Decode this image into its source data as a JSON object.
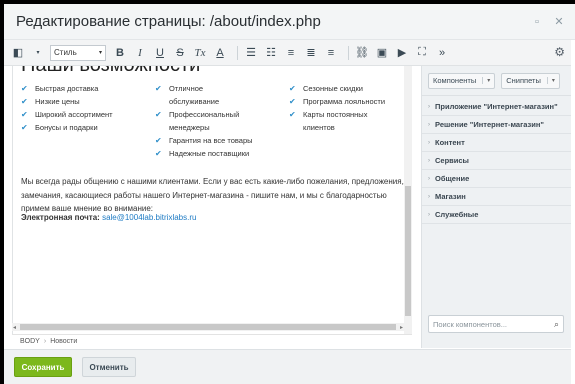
{
  "window": {
    "title": "Редактирование страницы: /about/index.php",
    "minimize_icon": "minimize-icon",
    "close_icon": "close-icon"
  },
  "toolbar": {
    "style_select": {
      "value": "Стиль"
    },
    "format_buttons": [
      "B",
      "I",
      "U",
      "S",
      "Tx",
      "A"
    ],
    "more": "»"
  },
  "editor": {
    "heading": "Наши возможности",
    "features": {
      "col1": [
        "Быстрая доставка",
        "Низкие цены",
        "Широкий ассортимент",
        "Бонусы и подарки"
      ],
      "col2": [
        "Отличное обслуживание",
        "Профессиональный менеджеры",
        "Гарантия на все товары",
        "Надежные поставщики"
      ],
      "col3": [
        "Сезонные скидки",
        "Программа лояльности",
        "Карты постоянных клиентов"
      ]
    },
    "paragraph": "Мы всегда рады общению с нашими клиентами. Если у вас есть какие-либо пожелания, предложения, замечания, касающиеся работы нашего Интернет-магазина - пишите нам, и мы с благодарностью примем ваше мнение во внимание:",
    "email_label": "Электронная почта",
    "email_value": "sale@1004lab.bitrixlabs.ru"
  },
  "statusbar": {
    "path": [
      "BODY",
      "Новости"
    ]
  },
  "panel": {
    "tabs": [
      {
        "label": "Компоненты"
      },
      {
        "label": "Сниппеты"
      }
    ],
    "groups": [
      "Приложение \"Интернет-магазин\"",
      "Решение \"Интернет-магазин\"",
      "Контент",
      "Сервисы",
      "Общение",
      "Магазин",
      "Служебные"
    ],
    "search": {
      "placeholder": "Поиск компонентов...",
      "value": ""
    }
  },
  "footer": {
    "save_label": "Сохранить",
    "cancel_label": "Отменить"
  },
  "colors": {
    "save_button": "#7cb81c",
    "link": "#1e7bc4",
    "checkmark": "#2f8fc9"
  }
}
